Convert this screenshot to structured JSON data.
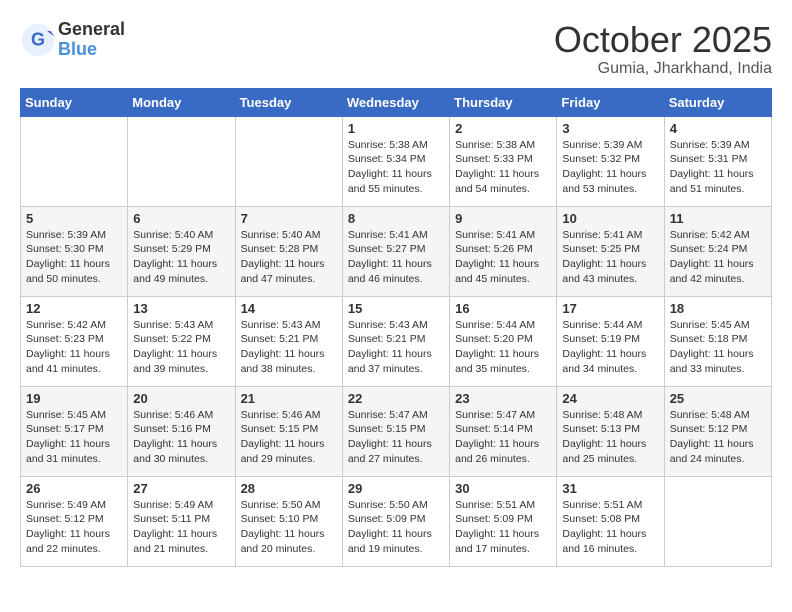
{
  "header": {
    "logo_general": "General",
    "logo_blue": "Blue",
    "month_title": "October 2025",
    "location": "Gumia, Jharkhand, India"
  },
  "calendar": {
    "days_of_week": [
      "Sunday",
      "Monday",
      "Tuesday",
      "Wednesday",
      "Thursday",
      "Friday",
      "Saturday"
    ],
    "weeks": [
      [
        {
          "day": "",
          "info": ""
        },
        {
          "day": "",
          "info": ""
        },
        {
          "day": "",
          "info": ""
        },
        {
          "day": "1",
          "info": "Sunrise: 5:38 AM\nSunset: 5:34 PM\nDaylight: 11 hours\nand 55 minutes."
        },
        {
          "day": "2",
          "info": "Sunrise: 5:38 AM\nSunset: 5:33 PM\nDaylight: 11 hours\nand 54 minutes."
        },
        {
          "day": "3",
          "info": "Sunrise: 5:39 AM\nSunset: 5:32 PM\nDaylight: 11 hours\nand 53 minutes."
        },
        {
          "day": "4",
          "info": "Sunrise: 5:39 AM\nSunset: 5:31 PM\nDaylight: 11 hours\nand 51 minutes."
        }
      ],
      [
        {
          "day": "5",
          "info": "Sunrise: 5:39 AM\nSunset: 5:30 PM\nDaylight: 11 hours\nand 50 minutes."
        },
        {
          "day": "6",
          "info": "Sunrise: 5:40 AM\nSunset: 5:29 PM\nDaylight: 11 hours\nand 49 minutes."
        },
        {
          "day": "7",
          "info": "Sunrise: 5:40 AM\nSunset: 5:28 PM\nDaylight: 11 hours\nand 47 minutes."
        },
        {
          "day": "8",
          "info": "Sunrise: 5:41 AM\nSunset: 5:27 PM\nDaylight: 11 hours\nand 46 minutes."
        },
        {
          "day": "9",
          "info": "Sunrise: 5:41 AM\nSunset: 5:26 PM\nDaylight: 11 hours\nand 45 minutes."
        },
        {
          "day": "10",
          "info": "Sunrise: 5:41 AM\nSunset: 5:25 PM\nDaylight: 11 hours\nand 43 minutes."
        },
        {
          "day": "11",
          "info": "Sunrise: 5:42 AM\nSunset: 5:24 PM\nDaylight: 11 hours\nand 42 minutes."
        }
      ],
      [
        {
          "day": "12",
          "info": "Sunrise: 5:42 AM\nSunset: 5:23 PM\nDaylight: 11 hours\nand 41 minutes."
        },
        {
          "day": "13",
          "info": "Sunrise: 5:43 AM\nSunset: 5:22 PM\nDaylight: 11 hours\nand 39 minutes."
        },
        {
          "day": "14",
          "info": "Sunrise: 5:43 AM\nSunset: 5:21 PM\nDaylight: 11 hours\nand 38 minutes."
        },
        {
          "day": "15",
          "info": "Sunrise: 5:43 AM\nSunset: 5:21 PM\nDaylight: 11 hours\nand 37 minutes."
        },
        {
          "day": "16",
          "info": "Sunrise: 5:44 AM\nSunset: 5:20 PM\nDaylight: 11 hours\nand 35 minutes."
        },
        {
          "day": "17",
          "info": "Sunrise: 5:44 AM\nSunset: 5:19 PM\nDaylight: 11 hours\nand 34 minutes."
        },
        {
          "day": "18",
          "info": "Sunrise: 5:45 AM\nSunset: 5:18 PM\nDaylight: 11 hours\nand 33 minutes."
        }
      ],
      [
        {
          "day": "19",
          "info": "Sunrise: 5:45 AM\nSunset: 5:17 PM\nDaylight: 11 hours\nand 31 minutes."
        },
        {
          "day": "20",
          "info": "Sunrise: 5:46 AM\nSunset: 5:16 PM\nDaylight: 11 hours\nand 30 minutes."
        },
        {
          "day": "21",
          "info": "Sunrise: 5:46 AM\nSunset: 5:15 PM\nDaylight: 11 hours\nand 29 minutes."
        },
        {
          "day": "22",
          "info": "Sunrise: 5:47 AM\nSunset: 5:15 PM\nDaylight: 11 hours\nand 27 minutes."
        },
        {
          "day": "23",
          "info": "Sunrise: 5:47 AM\nSunset: 5:14 PM\nDaylight: 11 hours\nand 26 minutes."
        },
        {
          "day": "24",
          "info": "Sunrise: 5:48 AM\nSunset: 5:13 PM\nDaylight: 11 hours\nand 25 minutes."
        },
        {
          "day": "25",
          "info": "Sunrise: 5:48 AM\nSunset: 5:12 PM\nDaylight: 11 hours\nand 24 minutes."
        }
      ],
      [
        {
          "day": "26",
          "info": "Sunrise: 5:49 AM\nSunset: 5:12 PM\nDaylight: 11 hours\nand 22 minutes."
        },
        {
          "day": "27",
          "info": "Sunrise: 5:49 AM\nSunset: 5:11 PM\nDaylight: 11 hours\nand 21 minutes."
        },
        {
          "day": "28",
          "info": "Sunrise: 5:50 AM\nSunset: 5:10 PM\nDaylight: 11 hours\nand 20 minutes."
        },
        {
          "day": "29",
          "info": "Sunrise: 5:50 AM\nSunset: 5:09 PM\nDaylight: 11 hours\nand 19 minutes."
        },
        {
          "day": "30",
          "info": "Sunrise: 5:51 AM\nSunset: 5:09 PM\nDaylight: 11 hours\nand 17 minutes."
        },
        {
          "day": "31",
          "info": "Sunrise: 5:51 AM\nSunset: 5:08 PM\nDaylight: 11 hours\nand 16 minutes."
        },
        {
          "day": "",
          "info": ""
        }
      ]
    ]
  }
}
